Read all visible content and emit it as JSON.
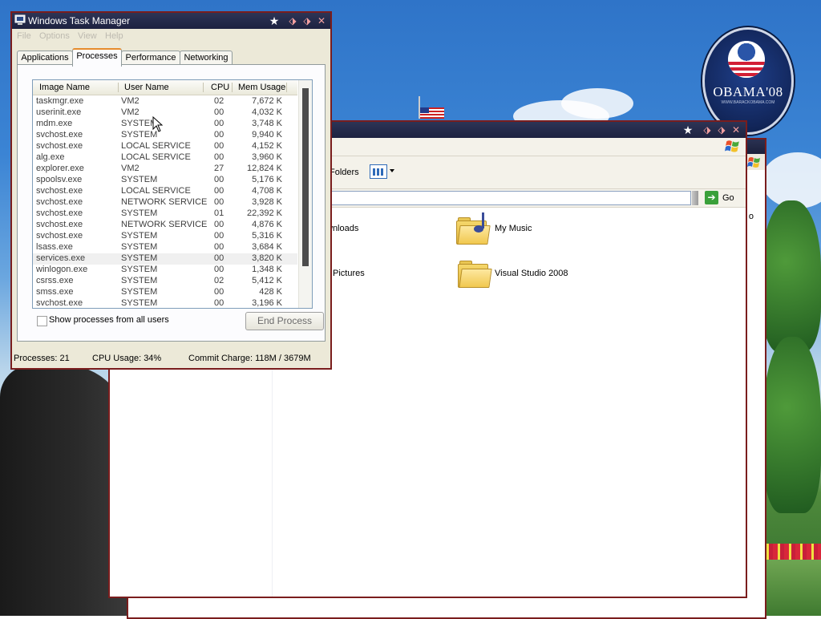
{
  "desktop": {
    "badge_text": "OBAMA'08",
    "badge_subtext": "WWW.BARACKOBAMA.COM"
  },
  "explorer": {
    "folders_label": "Folders",
    "go_label": "Go",
    "items": [
      {
        "label": "wnloads"
      },
      {
        "label": "My Music"
      },
      {
        "label": "Pictures"
      },
      {
        "label": "Visual Studio 2008"
      }
    ],
    "back_partial": "o"
  },
  "taskmanager": {
    "title": "Windows Task Manager",
    "menu": [
      "File",
      "Options",
      "View",
      "Help"
    ],
    "tabs": [
      "Applications",
      "Processes",
      "Performance",
      "Networking"
    ],
    "active_tab": "Processes",
    "columns": [
      "Image Name",
      "User Name",
      "CPU",
      "Mem Usage"
    ],
    "processes": [
      {
        "name": "taskmgr.exe",
        "user": "VM2",
        "cpu": "02",
        "mem": "7,672 K"
      },
      {
        "name": "userinit.exe",
        "user": "VM2",
        "cpu": "00",
        "mem": "4,032 K"
      },
      {
        "name": "mdm.exe",
        "user": "SYSTEM",
        "cpu": "00",
        "mem": "3,748 K"
      },
      {
        "name": "svchost.exe",
        "user": "SYSTEM",
        "cpu": "00",
        "mem": "9,940 K"
      },
      {
        "name": "svchost.exe",
        "user": "LOCAL SERVICE",
        "cpu": "00",
        "mem": "4,152 K"
      },
      {
        "name": "alg.exe",
        "user": "LOCAL SERVICE",
        "cpu": "00",
        "mem": "3,960 K"
      },
      {
        "name": "explorer.exe",
        "user": "VM2",
        "cpu": "27",
        "mem": "12,824 K"
      },
      {
        "name": "spoolsv.exe",
        "user": "SYSTEM",
        "cpu": "00",
        "mem": "5,176 K"
      },
      {
        "name": "svchost.exe",
        "user": "LOCAL SERVICE",
        "cpu": "00",
        "mem": "4,708 K"
      },
      {
        "name": "svchost.exe",
        "user": "NETWORK SERVICE",
        "cpu": "00",
        "mem": "3,928 K"
      },
      {
        "name": "svchost.exe",
        "user": "SYSTEM",
        "cpu": "01",
        "mem": "22,392 K"
      },
      {
        "name": "svchost.exe",
        "user": "NETWORK SERVICE",
        "cpu": "00",
        "mem": "4,876 K"
      },
      {
        "name": "svchost.exe",
        "user": "SYSTEM",
        "cpu": "00",
        "mem": "5,316 K"
      },
      {
        "name": "lsass.exe",
        "user": "SYSTEM",
        "cpu": "00",
        "mem": "3,684 K"
      },
      {
        "name": "services.exe",
        "user": "SYSTEM",
        "cpu": "00",
        "mem": "3,820 K"
      },
      {
        "name": "winlogon.exe",
        "user": "SYSTEM",
        "cpu": "00",
        "mem": "1,348 K"
      },
      {
        "name": "csrss.exe",
        "user": "SYSTEM",
        "cpu": "02",
        "mem": "5,412 K"
      },
      {
        "name": "smss.exe",
        "user": "SYSTEM",
        "cpu": "00",
        "mem": "428 K"
      },
      {
        "name": "svchost.exe",
        "user": "SYSTEM",
        "cpu": "00",
        "mem": "3,196 K"
      }
    ],
    "show_all_label": "Show processes from all users",
    "end_process_label": "End Process",
    "status": {
      "processes": "Processes: 21",
      "cpu": "CPU Usage: 34%",
      "commit": "Commit Charge: 118M / 3679M"
    }
  },
  "colors": {
    "frame_border": "#7a1d1d",
    "titlebar": "#1d2240",
    "active_tab_accent": "#e68b2c"
  }
}
